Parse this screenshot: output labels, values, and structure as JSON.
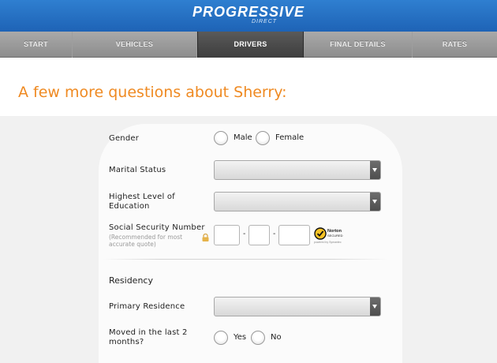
{
  "header": {
    "logo_text": "PROGRESSIVE",
    "logo_sub": "DIRECT",
    "colors": {
      "header_blue": "#2f7fd0",
      "title_orange": "#ef8a22"
    }
  },
  "nav": {
    "tabs": [
      {
        "label": "START",
        "active": false
      },
      {
        "label": "VEHICLES",
        "active": false
      },
      {
        "label": "DRIVERS",
        "active": true
      },
      {
        "label": "FINAL DETAILS",
        "active": false
      },
      {
        "label": "RATES",
        "active": false
      }
    ]
  },
  "page": {
    "title": "A few more questions about Sherry:"
  },
  "form": {
    "gender": {
      "label": "Gender",
      "options": [
        "Male",
        "Female"
      ]
    },
    "marital_status": {
      "label": "Marital Status",
      "value": ""
    },
    "education": {
      "label_line1": "Highest Level of",
      "label_line2": "Education",
      "value": ""
    },
    "ssn": {
      "label": "Social Security Number",
      "hint_line1": "(Recommended for most",
      "hint_line2": "accurate quote)",
      "dash": "-",
      "badge_line1": "Norton",
      "badge_line2": "SECURED",
      "badge_sub": "powered by Symantec",
      "icons": [
        "lock-icon",
        "norton-secured-icon"
      ]
    },
    "residency": {
      "heading": "Residency",
      "primary_residence": {
        "label": "Primary Residence",
        "value": ""
      },
      "moved": {
        "label_line1": "Moved in the last 2",
        "label_line2": "months?",
        "options": [
          "Yes",
          "No"
        ]
      }
    }
  }
}
